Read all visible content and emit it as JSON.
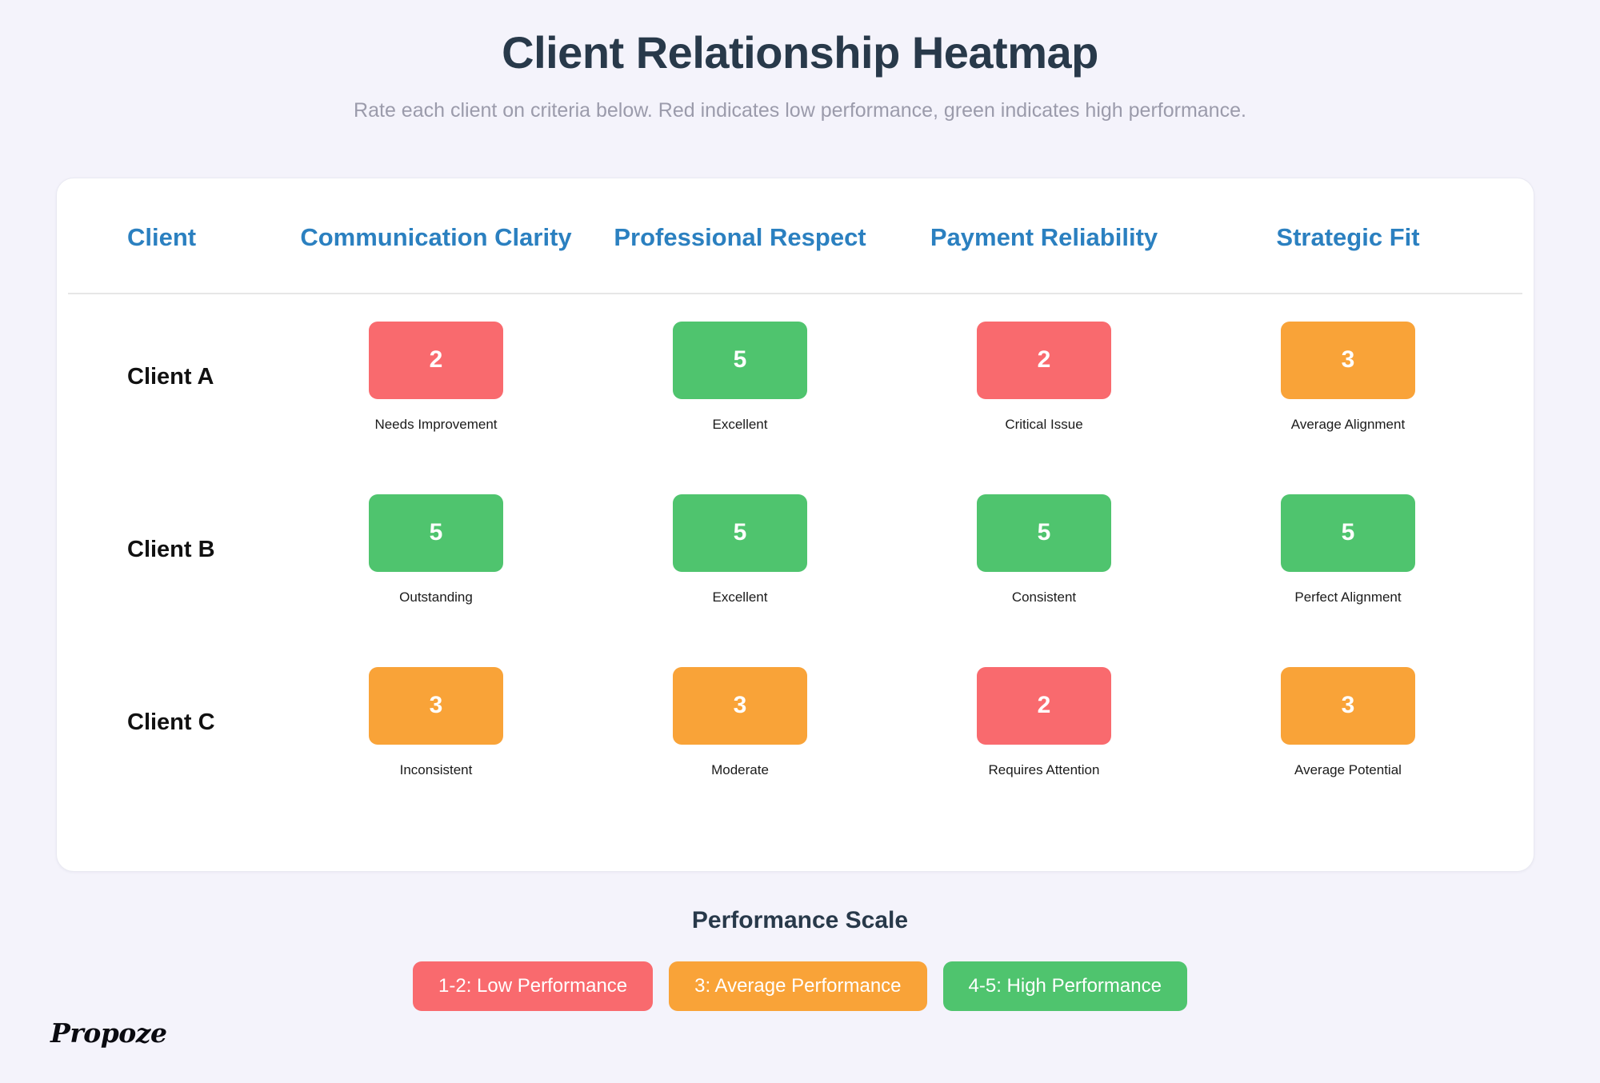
{
  "header": {
    "title": "Client Relationship Heatmap",
    "subtitle": "Rate each client on criteria below. Red indicates low performance, green indicates high performance."
  },
  "colors": {
    "low": "#f96a6e",
    "average": "#f9a338",
    "high": "#4fc46e",
    "header_blue": "#2b80c0",
    "page_background": "#f4f3fb",
    "card_background": "#ffffff",
    "title_color": "#28394a"
  },
  "table": {
    "columns": [
      "Client",
      "Communication Clarity",
      "Professional Respect",
      "Payment Reliability",
      "Strategic Fit"
    ],
    "rows": [
      {
        "client": "Client A",
        "cells": [
          {
            "score": "2",
            "caption": "Needs Improvement",
            "level": "low"
          },
          {
            "score": "5",
            "caption": "Excellent",
            "level": "high"
          },
          {
            "score": "2",
            "caption": "Critical Issue",
            "level": "low"
          },
          {
            "score": "3",
            "caption": "Average Alignment",
            "level": "average"
          }
        ]
      },
      {
        "client": "Client B",
        "cells": [
          {
            "score": "5",
            "caption": "Outstanding",
            "level": "high"
          },
          {
            "score": "5",
            "caption": "Excellent",
            "level": "high"
          },
          {
            "score": "5",
            "caption": "Consistent",
            "level": "high"
          },
          {
            "score": "5",
            "caption": "Perfect Alignment",
            "level": "high"
          }
        ]
      },
      {
        "client": "Client C",
        "cells": [
          {
            "score": "3",
            "caption": "Inconsistent",
            "level": "average"
          },
          {
            "score": "3",
            "caption": "Moderate",
            "level": "average"
          },
          {
            "score": "2",
            "caption": "Requires Attention",
            "level": "low"
          },
          {
            "score": "3",
            "caption": "Average Potential",
            "level": "average"
          }
        ]
      }
    ]
  },
  "legend": {
    "title": "Performance Scale",
    "chips": [
      {
        "label": "1-2: Low Performance",
        "level": "low"
      },
      {
        "label": "3: Average Performance",
        "level": "average"
      },
      {
        "label": "4-5: High Performance",
        "level": "high"
      }
    ]
  },
  "brand": {
    "name": "Propoze"
  }
}
